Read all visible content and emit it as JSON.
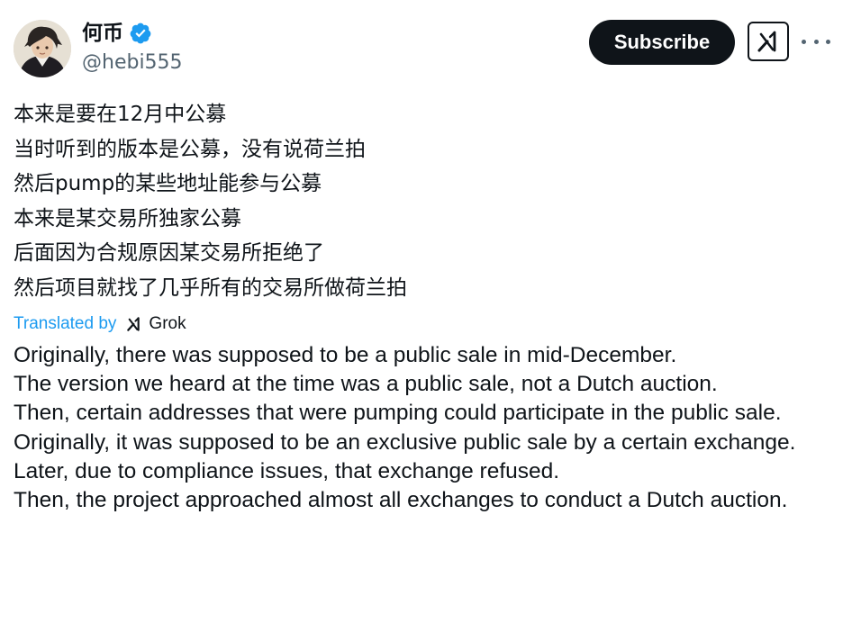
{
  "author": {
    "display_name": "何币",
    "handle": "@hebi555",
    "verified": true,
    "verified_color": "#1d9bf0"
  },
  "actions": {
    "subscribe_label": "Subscribe",
    "grok_icon": "grok-icon",
    "more_icon": "more-icon"
  },
  "post": {
    "original_lines": [
      "本来是要在12月中公募",
      "当时听到的版本是公募，没有说荷兰拍",
      "然后pump的某些地址能参与公募",
      "本来是某交易所独家公募",
      "后面因为合规原因某交易所拒绝了",
      "然后项目就找了几乎所有的交易所做荷兰拍"
    ],
    "translation": {
      "label": "Translated by",
      "provider": "Grok",
      "lines": [
        "Originally, there was supposed to be a public sale in mid-December.",
        "The version we heard at the time was a public sale, not a Dutch auction.",
        "Then, certain addresses that were pumping could participate in the public sale.",
        "Originally, it was supposed to be an exclusive public sale by a certain exchange.",
        "Later, due to compliance issues, that exchange refused.",
        "Then, the project approached almost all exchanges to conduct a Dutch auction."
      ]
    }
  },
  "colors": {
    "text": "#0f1419",
    "secondary": "#536471",
    "accent": "#1d9bf0"
  }
}
